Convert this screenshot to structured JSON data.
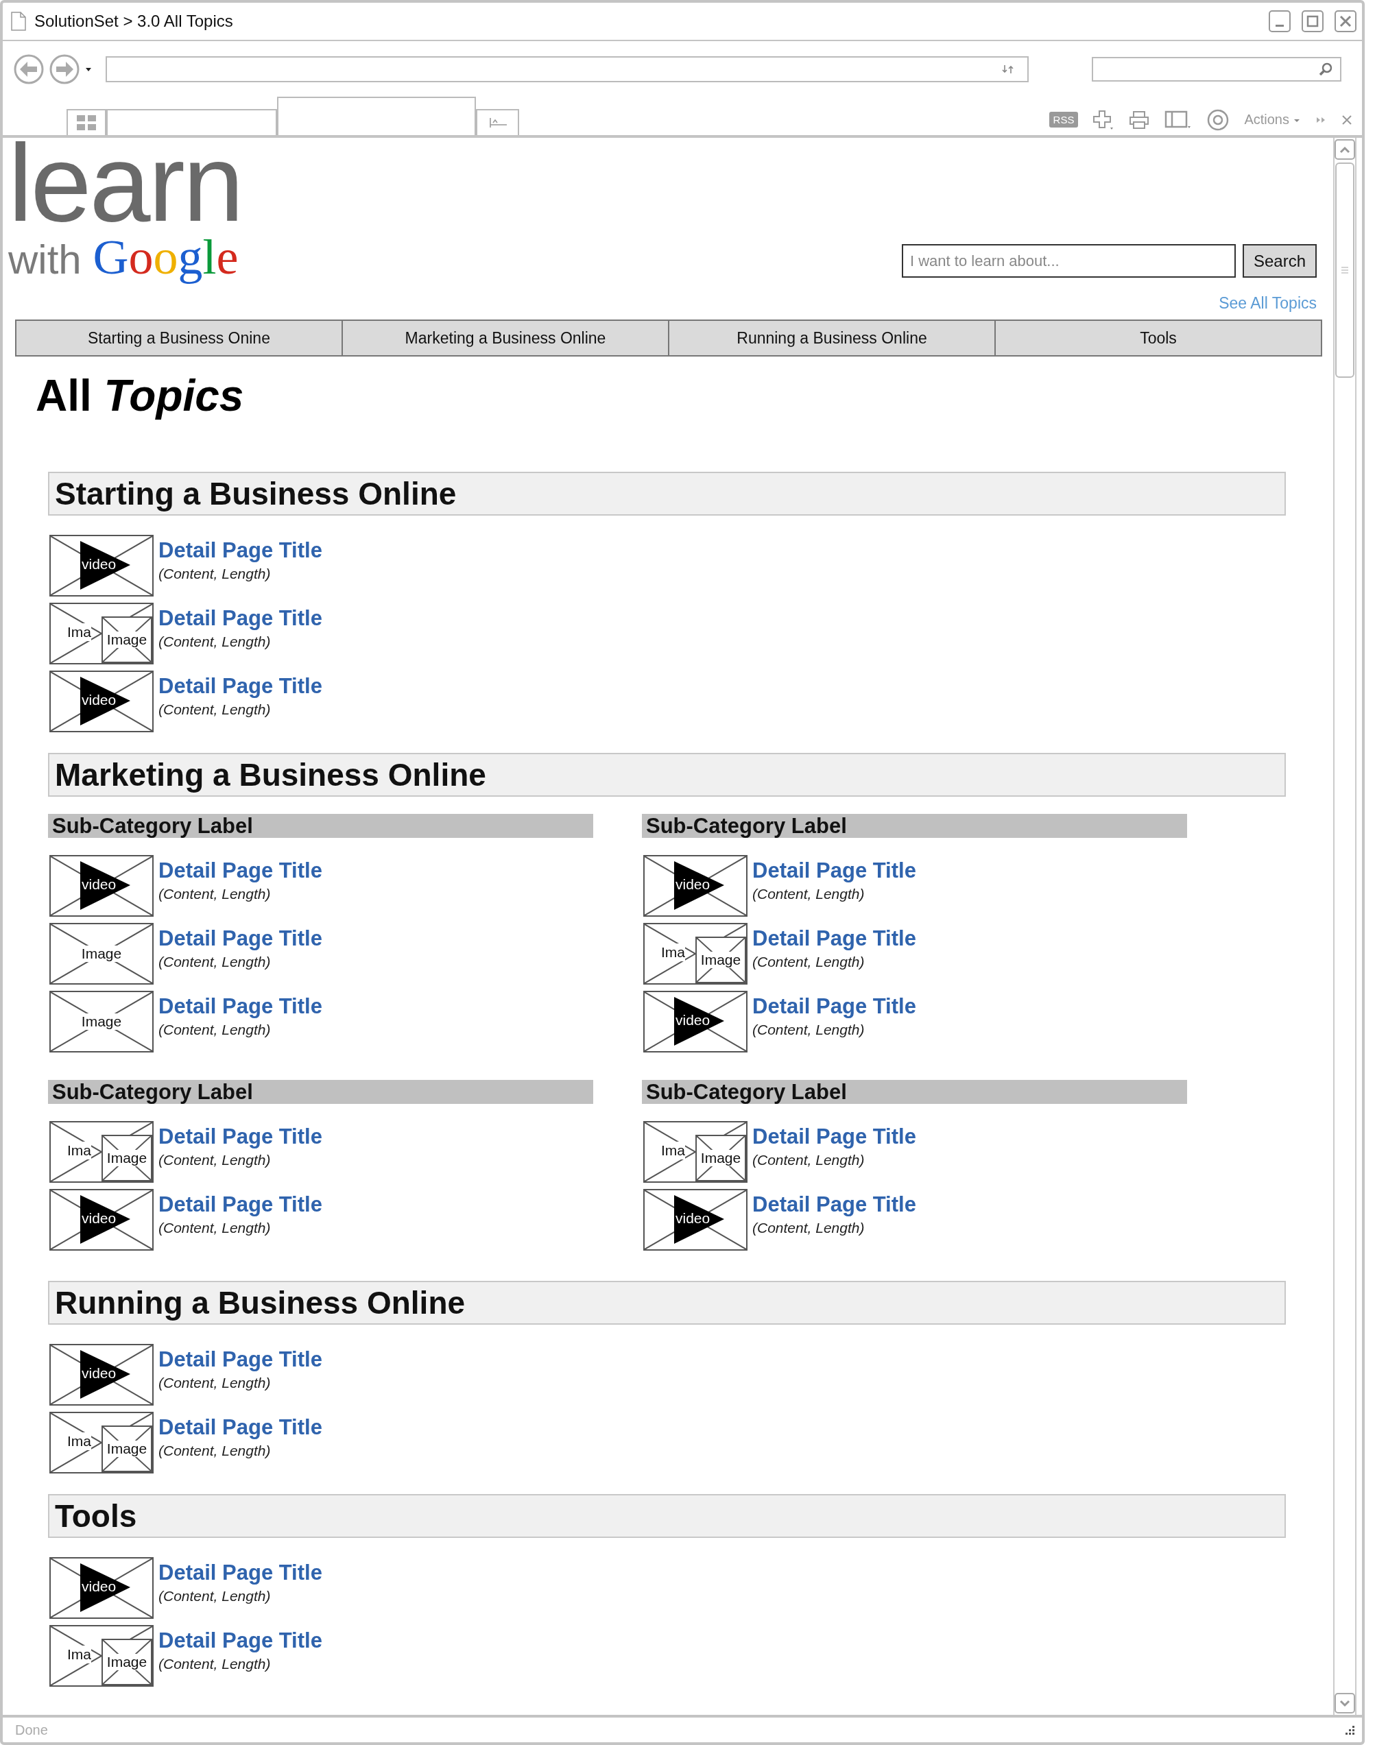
{
  "window": {
    "title": "SolutionSet > 3.0 All Topics"
  },
  "toolbar": {
    "rss": "RSS",
    "actions": "Actions"
  },
  "tabs": [
    {
      "selected": false
    },
    {
      "selected": true
    }
  ],
  "site": {
    "logo": {
      "word": "learn",
      "tagline": "with",
      "brand": "Google"
    },
    "search": {
      "placeholder": "I want to learn about...",
      "button": "Search"
    },
    "see_all": "See All Topics",
    "nav": [
      "Starting a Business Onine",
      "Marketing a Business Online",
      "Running a Business Online",
      "Tools"
    ]
  },
  "heading": "All *Topics*",
  "sections": [
    {
      "title": "Starting a Business Online",
      "items": [
        {
          "thumb": {
            "kind": "video",
            "label": "video"
          },
          "title": "Detail Page Title",
          "meta": "(Content, Length)"
        },
        {
          "thumb": {
            "kind": "stack",
            "back_label": "Ima",
            "label": "Image"
          },
          "title": "Detail Page Title",
          "meta": "(Content, Length)"
        },
        {
          "thumb": {
            "kind": "video",
            "label": "video"
          },
          "title": "Detail Page Title",
          "meta": "(Content, Length)"
        }
      ]
    },
    {
      "title": "Marketing a Business Online",
      "subcategories": [
        {
          "label": "Sub-Category Label",
          "items": [
            {
              "thumb": {
                "kind": "video",
                "label": "video"
              },
              "title": "Detail Page Title",
              "meta": "(Content, Length)"
            },
            {
              "thumb": {
                "kind": "image",
                "label": "Image"
              },
              "title": "Detail Page Title",
              "meta": "(Content, Length)"
            },
            {
              "thumb": {
                "kind": "image",
                "label": "Image"
              },
              "title": "Detail Page Title",
              "meta": "(Content, Length)"
            }
          ]
        },
        {
          "label": "Sub-Category Label",
          "items": [
            {
              "thumb": {
                "kind": "video",
                "label": "video"
              },
              "title": "Detail Page Title",
              "meta": "(Content, Length)"
            },
            {
              "thumb": {
                "kind": "stack",
                "back_label": "Ima",
                "label": "Image"
              },
              "title": "Detail Page Title",
              "meta": "(Content, Length)"
            },
            {
              "thumb": {
                "kind": "video",
                "label": "video"
              },
              "title": "Detail Page Title",
              "meta": "(Content, Length)"
            }
          ]
        },
        {
          "label": "Sub-Category Label",
          "items": [
            {
              "thumb": {
                "kind": "stack",
                "back_label": "Ima",
                "label": "Image"
              },
              "title": "Detail Page Title",
              "meta": "(Content, Length)"
            },
            {
              "thumb": {
                "kind": "video",
                "label": "video"
              },
              "title": "Detail Page Title",
              "meta": "(Content, Length)"
            }
          ]
        },
        {
          "label": "Sub-Category Label",
          "items": [
            {
              "thumb": {
                "kind": "stack",
                "back_label": "Ima",
                "label": "Image"
              },
              "title": "Detail Page Title",
              "meta": "(Content, Length)"
            },
            {
              "thumb": {
                "kind": "video",
                "label": "video"
              },
              "title": "Detail Page Title",
              "meta": "(Content, Length)"
            }
          ]
        }
      ]
    },
    {
      "title": "Running a Business Online",
      "items": [
        {
          "thumb": {
            "kind": "video",
            "label": "video"
          },
          "title": "Detail Page Title",
          "meta": "(Content, Length)"
        },
        {
          "thumb": {
            "kind": "stack",
            "back_label": "Ima",
            "label": "Image"
          },
          "title": "Detail Page Title",
          "meta": "(Content, Length)"
        }
      ]
    },
    {
      "title": "Tools",
      "items": [
        {
          "thumb": {
            "kind": "video",
            "label": "video"
          },
          "title": "Detail Page Title",
          "meta": "(Content, Length)"
        },
        {
          "thumb": {
            "kind": "stack",
            "back_label": "Ima",
            "label": "Image"
          },
          "title": "Detail Page Title",
          "meta": "(Content, Length)"
        }
      ]
    }
  ],
  "status_bar": "Done"
}
